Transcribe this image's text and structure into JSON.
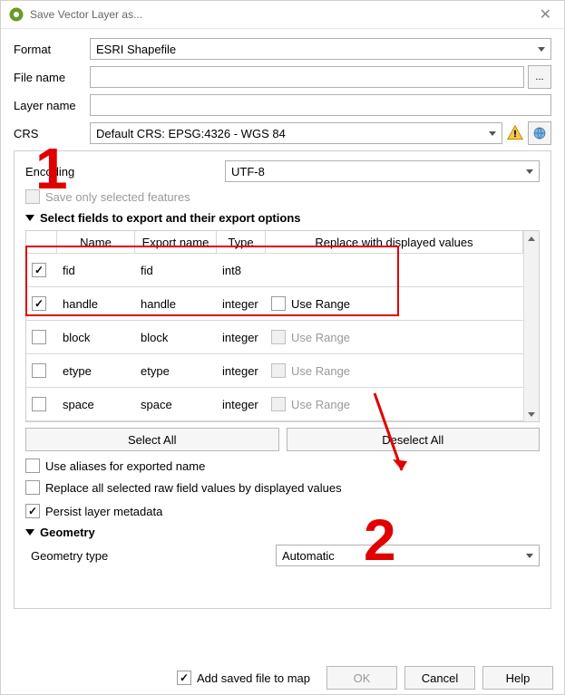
{
  "window": {
    "title": "Save Vector Layer as..."
  },
  "form": {
    "format_label": "Format",
    "format_value": "ESRI Shapefile",
    "file_label": "File name",
    "file_value": "",
    "browse": "...",
    "layer_label": "Layer name",
    "layer_value": "",
    "crs_label": "CRS",
    "crs_value": "Default CRS: EPSG:4326 - WGS 84"
  },
  "encoding": {
    "label": "Encoding",
    "value": "UTF-8"
  },
  "opts": {
    "save_selected": "Save only selected features",
    "section_fields": "Select fields to export and their export options",
    "select_all": "Select All",
    "deselect_all": "Deselect All",
    "aliases": "Use aliases for exported name",
    "replace_all": "Replace all selected raw field values by displayed values",
    "persist": "Persist layer metadata",
    "section_geom": "Geometry",
    "geom_type_label": "Geometry type",
    "geom_type_value": "Automatic"
  },
  "table": {
    "headers": {
      "name": "Name",
      "export": "Export name",
      "type": "Type",
      "replace": "Replace with displayed values"
    },
    "rows": [
      {
        "checked": true,
        "enabled": true,
        "name": "fid",
        "export": "fid",
        "type": "int8",
        "range": false,
        "range_label": ""
      },
      {
        "checked": true,
        "enabled": true,
        "name": "handle",
        "export": "handle",
        "type": "integer",
        "range": true,
        "range_label": "Use Range"
      },
      {
        "checked": false,
        "enabled": false,
        "name": "block",
        "export": "block",
        "type": "integer",
        "range": true,
        "range_label": "Use Range"
      },
      {
        "checked": false,
        "enabled": false,
        "name": "etype",
        "export": "etype",
        "type": "integer",
        "range": true,
        "range_label": "Use Range"
      },
      {
        "checked": false,
        "enabled": false,
        "name": "space",
        "export": "space",
        "type": "integer",
        "range": true,
        "range_label": "Use Range"
      }
    ]
  },
  "footer": {
    "add_map": "Add saved file to map",
    "ok": "OK",
    "cancel": "Cancel",
    "help": "Help"
  },
  "annotations": {
    "one": "1",
    "two": "2"
  }
}
